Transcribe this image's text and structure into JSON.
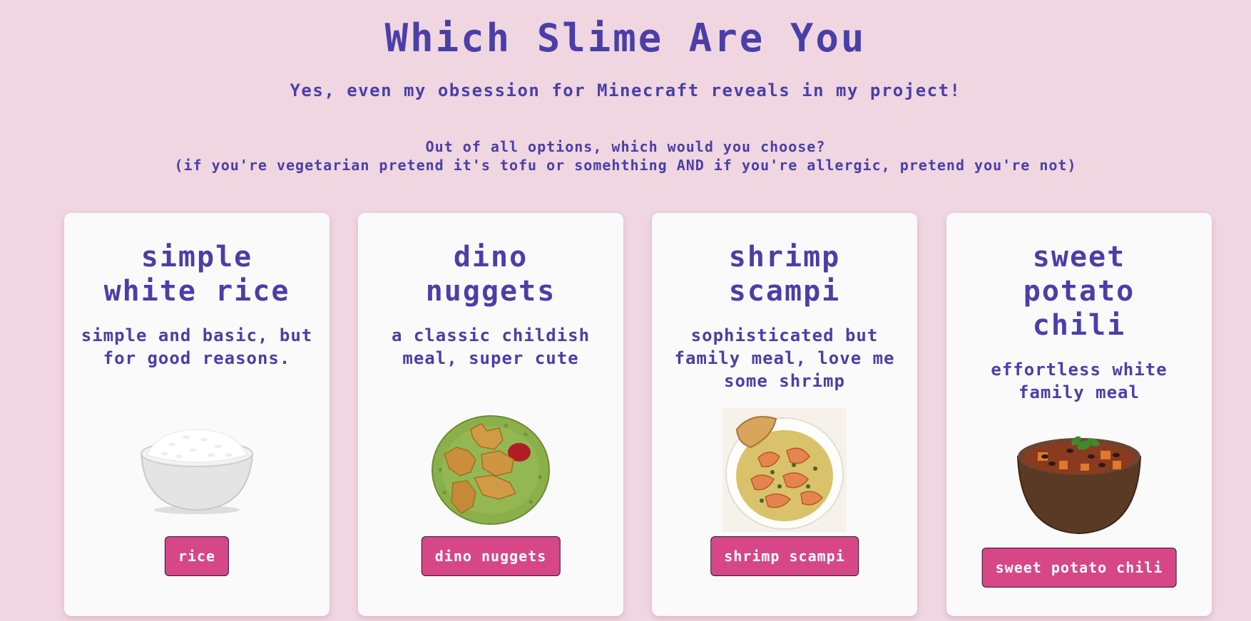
{
  "header": {
    "title": "Which Slime Are You",
    "subtitle": "Yes, even my obsession for Minecraft reveals in my project!",
    "question_line1": "Out of all options, which would you choose?",
    "question_line2": "(if you're vegetarian pretend it's tofu or somehthing AND if you're allergic, pretend you're not)"
  },
  "cards": [
    {
      "title": "simple white rice",
      "description": "simple and basic, but for good reasons.",
      "image": "rice-bowl",
      "button": "rice"
    },
    {
      "title": "dino nuggets",
      "description": "a classic childish meal, super cute",
      "image": "dino-nuggets-plate",
      "button": "dino nuggets"
    },
    {
      "title": "shrimp scampi",
      "description": "sophisticated but family meal, love me some shrimp",
      "image": "shrimp-scampi-bowl",
      "button": "shrimp scampi"
    },
    {
      "title": "sweet potato chili",
      "description": "effortless white family meal",
      "image": "chili-bowl",
      "button": "sweet potato chili"
    }
  ],
  "colors": {
    "background": "#efd6e0",
    "text": "#4a3fa8",
    "card": "#fafafa",
    "button": "#d74787"
  }
}
